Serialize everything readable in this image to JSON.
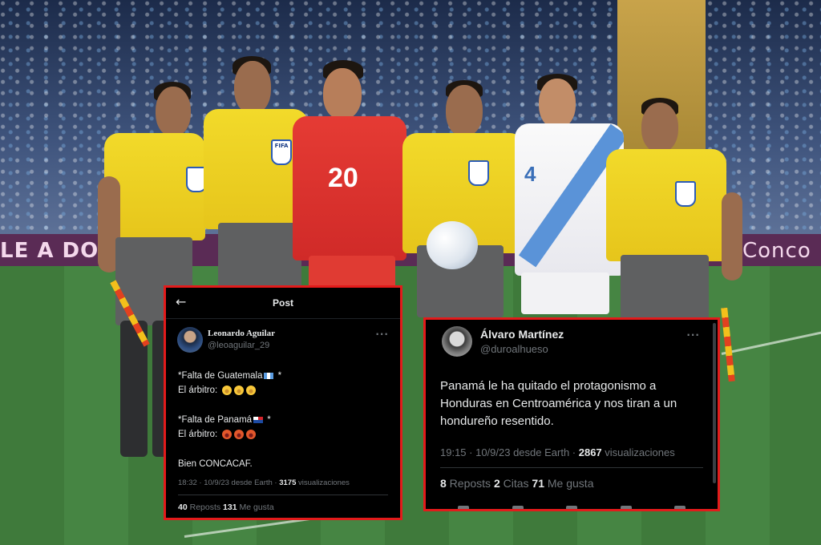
{
  "background": {
    "stadium_board_texts": [
      "LE A DONA",
      "Conco"
    ],
    "jersey_numbers": [
      "20",
      "4"
    ],
    "badge_text": "FIFA"
  },
  "tweet1": {
    "header": {
      "back_icon": "arrow-left-icon",
      "title": "Post"
    },
    "author": {
      "display_name": "Leonardo Aguilar",
      "handle": "@leoaguilar_29"
    },
    "more_icon": "more-icon",
    "lines": {
      "l1": "*Falta de Guatemala",
      "l1_end": " *",
      "l2": "El árbitro:",
      "l3": "*Falta de Panamá",
      "l3_end": " *",
      "l4": "El árbitro:",
      "l5": "Bien CONCACAF."
    },
    "meta": {
      "time": "18:32 · 10/9/23 desde Earth · ",
      "views_count": "3175",
      "views_label": " visualizaciones"
    },
    "stats": {
      "reposts_count": "40",
      "reposts_label": " Reposts ",
      "likes_count": "131",
      "likes_label": " Me gusta"
    }
  },
  "tweet2": {
    "author": {
      "display_name": "Álvaro Martínez",
      "handle": "@duroalhueso"
    },
    "more_icon": "more-icon",
    "text": "Panamá le ha quitado el protagonismo a Honduras en Centroamérica y nos tiran a un hondureño resentido.",
    "meta": {
      "time": "19:15 · 10/9/23 desde Earth · ",
      "views_count": "2867",
      "views_label": " visualizaciones"
    },
    "stats": {
      "reposts_count": "8",
      "reposts_label": " Reposts ",
      "quotes_count": "2",
      "quotes_label": " Citas ",
      "likes_count": "71",
      "likes_label": " Me gusta"
    }
  },
  "colors": {
    "highlight_border": "#e21b1b",
    "card_bg": "#000000",
    "muted_text": "#71767b"
  }
}
